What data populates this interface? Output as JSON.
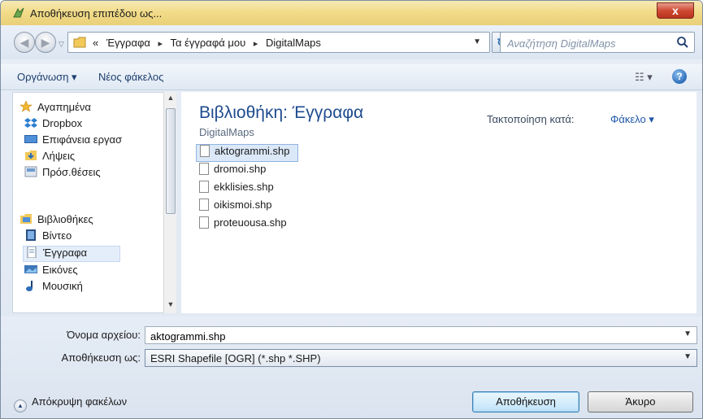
{
  "window": {
    "title": "Αποθήκευση επιπέδου ως...",
    "close_label": "x"
  },
  "address": {
    "crumb_prefix": "«",
    "crumbs": [
      "Έγγραφα",
      "Τα έγγραφά μου",
      "DigitalMaps"
    ],
    "separator": "▸"
  },
  "search": {
    "placeholder": "Αναζήτηση DigitalMaps"
  },
  "toolbar": {
    "organize_label": "Οργάνωση ▾",
    "new_folder_label": "Νέος φάκελος",
    "view_label": "☷ ▾",
    "help_label": "?"
  },
  "nav": {
    "favorites": [
      "Αγαπημένα",
      "Dropbox",
      "Επιφάνεια εργασ",
      "Λήψεις",
      "Πρόσ.θέσεις"
    ],
    "libraries": [
      "Βιβλιοθήκες",
      "Βίντεο",
      "Έγγραφα",
      "Εικόνες",
      "Μουσική"
    ],
    "selected": "Έγγραφα"
  },
  "main": {
    "library_title": "Βιβλιοθήκη: Έγγραφα",
    "library_subtitle": "DigitalMaps",
    "arrange_label": "Τακτοποίηση κατά:",
    "arrange_value": "Φάκελο ▾",
    "files": [
      "aktogrammi.shp",
      "dromoi.shp",
      "ekklisies.shp",
      "oikismoi.shp",
      "proteuousa.shp"
    ],
    "selected_file": "aktogrammi.shp"
  },
  "form": {
    "filename_label": "Όνομα αρχείου:",
    "filename_value": "aktogrammi.shp",
    "savetype_label": "Αποθήκευση ως:",
    "savetype_value": "ESRI Shapefile [OGR] (*.shp *.SHP)"
  },
  "footer": {
    "hide_folders_label": "Απόκρυψη φακέλων",
    "save_button": "Αποθήκευση",
    "cancel_button": "Άκυρο"
  },
  "colors": {
    "title_bar": "#f2dc8a",
    "library_title": "#1e4b8f",
    "link": "#1e56a8",
    "close_button": "#cf4a33"
  }
}
